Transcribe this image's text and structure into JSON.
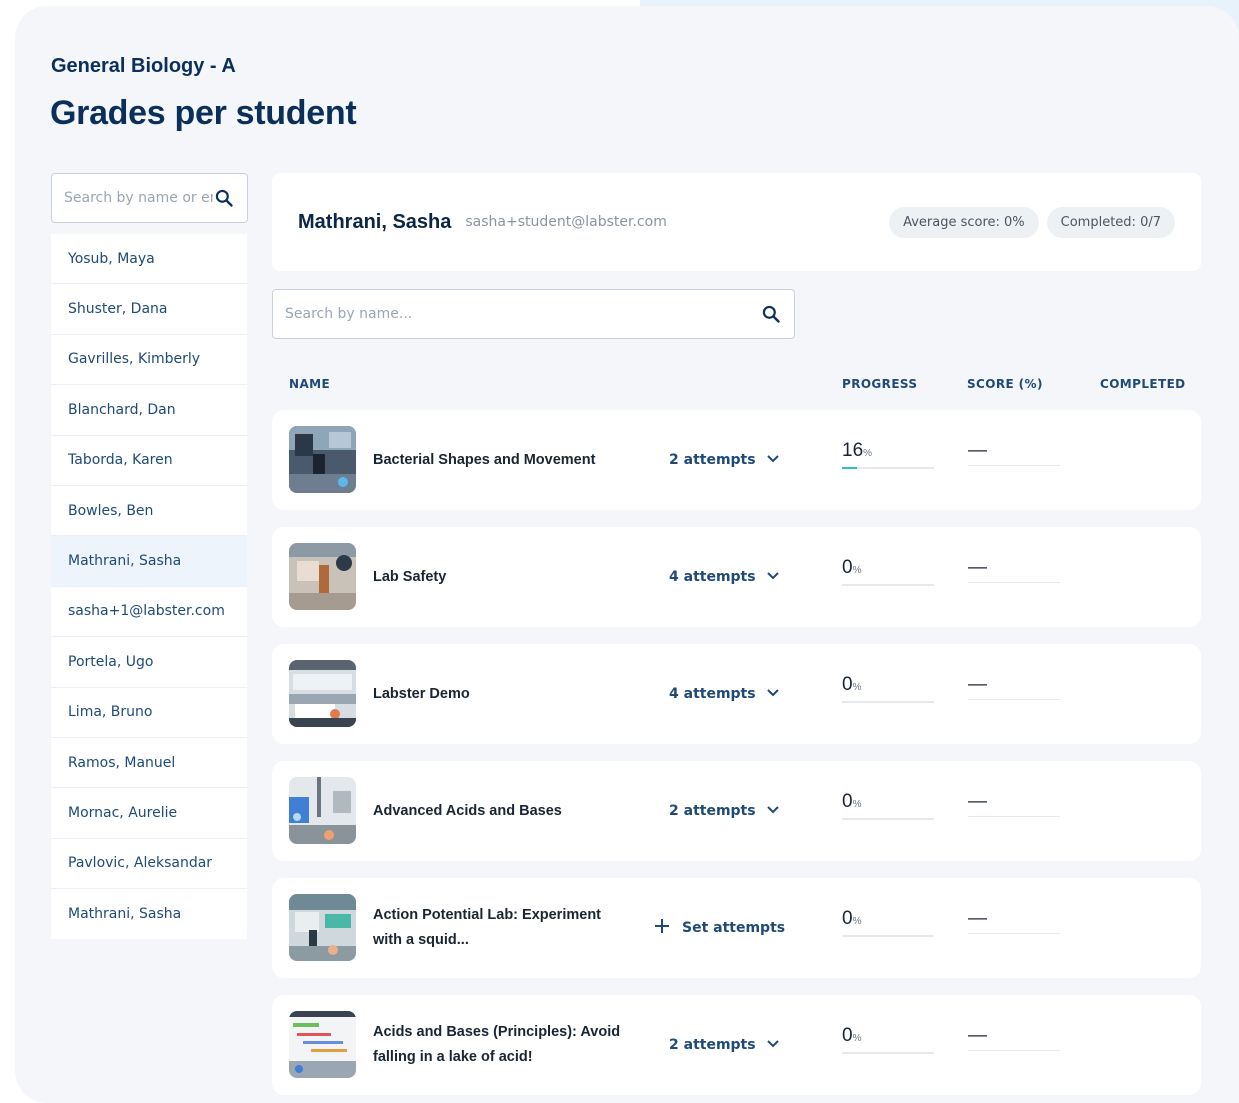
{
  "course": {
    "title": "General Biology - A"
  },
  "page": {
    "title": "Grades per student"
  },
  "sidebar": {
    "search_placeholder": "Search by name or email",
    "students": [
      {
        "label": "Yosub, Maya"
      },
      {
        "label": "Shuster, Dana"
      },
      {
        "label": "Gavrilles, Kimberly"
      },
      {
        "label": "Blanchard, Dan"
      },
      {
        "label": "Taborda, Karen"
      },
      {
        "label": "Bowles, Ben"
      },
      {
        "label": "Mathrani, Sasha",
        "selected": true
      },
      {
        "label": "sasha+1@labster.com"
      },
      {
        "label": "Portela, Ugo"
      },
      {
        "label": "Lima, Bruno"
      },
      {
        "label": "Ramos, Manuel"
      },
      {
        "label": "Mornac, Aurelie"
      },
      {
        "label": "Pavlovic, Aleksandar"
      },
      {
        "label": "Mathrani, Sasha"
      }
    ]
  },
  "student": {
    "name": "Mathrani, Sasha",
    "email": "sasha+student@labster.com",
    "average_score": "Average score: 0%",
    "completed": "Completed: 0/7"
  },
  "course_search": {
    "placeholder": "Search by name..."
  },
  "table": {
    "headers": {
      "name": "NAME",
      "progress": "PROGRESS",
      "score": "SCORE (%)",
      "completed": "COMPLETED"
    },
    "pct_symbol": "%",
    "score_dash": "—",
    "set_attempts_label": "Set attempts",
    "rows": [
      {
        "name": "Bacterial Shapes and Movement",
        "attempts": "2 attempts",
        "progress": 16
      },
      {
        "name": "Lab Safety",
        "attempts": "4 attempts",
        "progress": 0
      },
      {
        "name": "Labster Demo",
        "attempts": "4 attempts",
        "progress": 0
      },
      {
        "name": "Advanced Acids and Bases",
        "attempts": "2 attempts",
        "progress": 0
      },
      {
        "name": "Action Potential Lab: Experiment with a squid...",
        "attempts": null,
        "progress": 0
      },
      {
        "name": "Acids and Bases (Principles): Avoid falling in a lake of acid!",
        "attempts": "2 attempts",
        "progress": 0
      }
    ]
  },
  "colors": {
    "accent": "#0b2f5b",
    "progress": "#2ec4b6",
    "link": "#1f4a78"
  }
}
